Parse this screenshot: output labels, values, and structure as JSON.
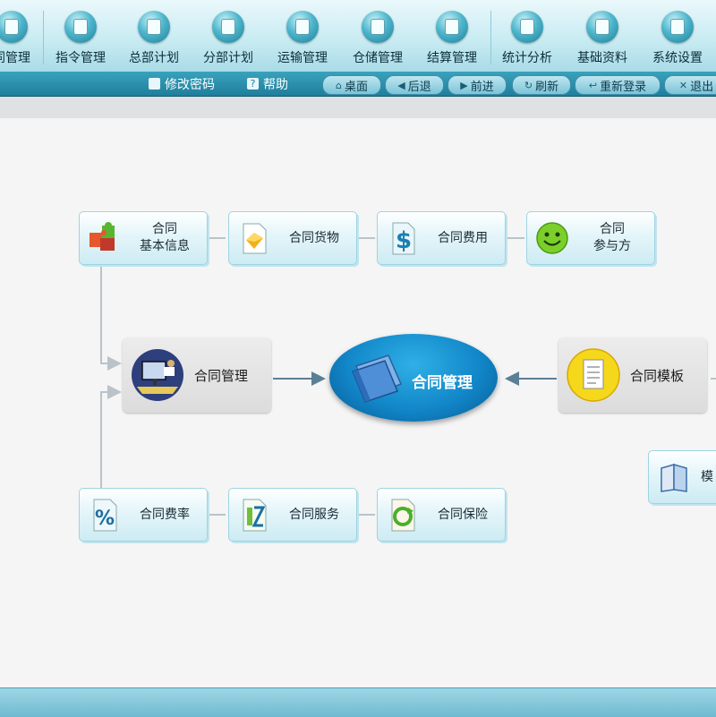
{
  "menu": {
    "items": [
      {
        "label": "同管理",
        "icon": "contract-icon"
      },
      {
        "label": "指令管理",
        "icon": "instruction-icon"
      },
      {
        "label": "总部计划",
        "icon": "hq-plan-icon"
      },
      {
        "label": "分部计划",
        "icon": "branch-plan-icon"
      },
      {
        "label": "运输管理",
        "icon": "truck-icon"
      },
      {
        "label": "仓储管理",
        "icon": "warehouse-icon"
      },
      {
        "label": "结算管理",
        "icon": "dollar-icon"
      },
      {
        "label": "统计分析",
        "icon": "statistics-icon"
      },
      {
        "label": "基础资料",
        "icon": "folder-icon"
      },
      {
        "label": "系统设置",
        "icon": "settings-icon"
      }
    ]
  },
  "toolbar": {
    "change_password": "修改密码",
    "help": "帮助",
    "buttons": {
      "desktop": "桌面",
      "back": "后退",
      "forward": "前进",
      "refresh": "刷新",
      "relogin": "重新登录",
      "exit": "退出"
    }
  },
  "diagram": {
    "center": "合同管理",
    "left_hub": "合同管理",
    "right_hub": "合同模板",
    "right_partial": "模",
    "top_row": [
      {
        "label": "合同\n基本信息",
        "icon": "puzzle-icon"
      },
      {
        "label": "合同货物",
        "icon": "goods-document-icon"
      },
      {
        "label": "合同费用",
        "icon": "dollar-document-icon"
      },
      {
        "label": "合同\n参与方",
        "icon": "smiley-icon"
      }
    ],
    "bottom_row": [
      {
        "label": "合同费率",
        "icon": "percent-document-icon"
      },
      {
        "label": "合同服务",
        "icon": "service-document-icon"
      },
      {
        "label": "合同保险",
        "icon": "insurance-document-icon"
      }
    ]
  },
  "colors": {
    "accent": "#1f7f9c",
    "oval": "#1287c9",
    "card_border": "#9dd4e2"
  }
}
